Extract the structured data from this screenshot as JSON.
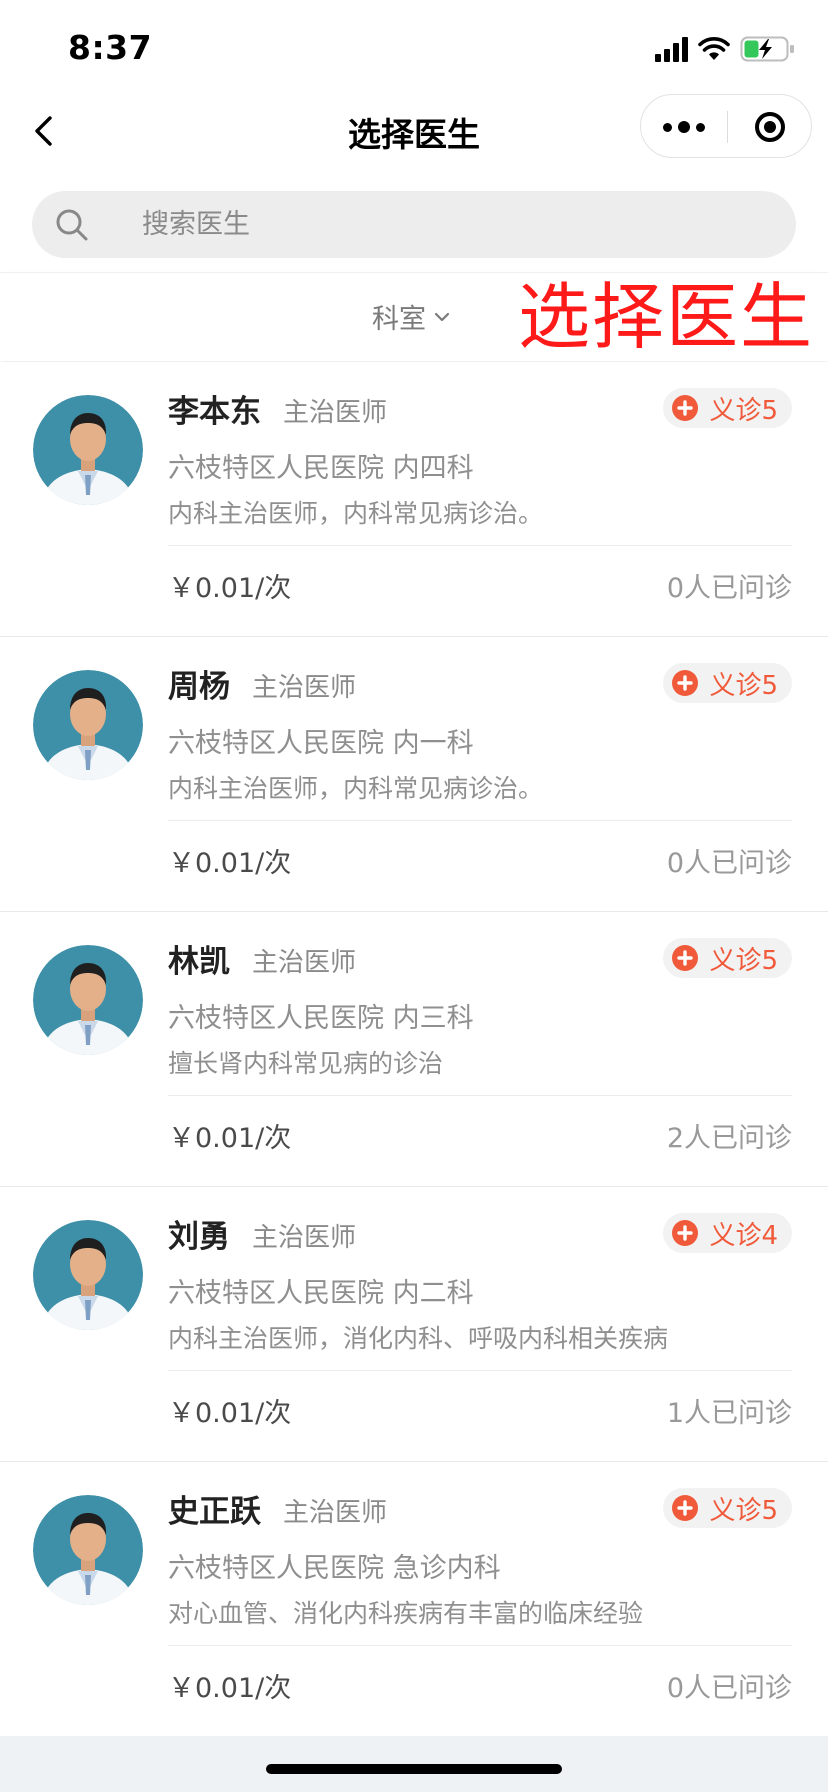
{
  "status_bar": {
    "time": "8:37"
  },
  "nav": {
    "title": "选择医生"
  },
  "search": {
    "placeholder": "搜索医生"
  },
  "filter": {
    "department_label": "科室",
    "overlay_label": "选择医生"
  },
  "colors": {
    "accent": "#f05a3a",
    "overlay": "#ff1a1a",
    "battery": "#34c759"
  },
  "doctors": [
    {
      "name": "李本东",
      "title": "主治医师",
      "badge": "义诊5",
      "hospital": "六枝特区人民医院  内四科",
      "intro": "内科主治医师，内科常见病诊治。",
      "price": "￥0.01/次",
      "consults": "0人已问诊"
    },
    {
      "name": "周杨",
      "title": "主治医师",
      "badge": "义诊5",
      "hospital": "六枝特区人民医院  内一科",
      "intro": "内科主治医师，内科常见病诊治。",
      "price": "￥0.01/次",
      "consults": "0人已问诊"
    },
    {
      "name": "林凯",
      "title": "主治医师",
      "badge": "义诊5",
      "hospital": "六枝特区人民医院  内三科",
      "intro": "擅长肾内科常见病的诊治",
      "price": "￥0.01/次",
      "consults": "2人已问诊"
    },
    {
      "name": "刘勇",
      "title": "主治医师",
      "badge": "义诊4",
      "hospital": "六枝特区人民医院  内二科",
      "intro": "内科主治医师，消化内科、呼吸内科相关疾病",
      "price": "￥0.01/次",
      "consults": "1人已问诊"
    },
    {
      "name": "史正跃",
      "title": "主治医师",
      "badge": "义诊5",
      "hospital": "六枝特区人民医院  急诊内科",
      "intro": "对心血管、消化内科疾病有丰富的临床经验",
      "price": "￥0.01/次",
      "consults": "0人已问诊"
    }
  ]
}
